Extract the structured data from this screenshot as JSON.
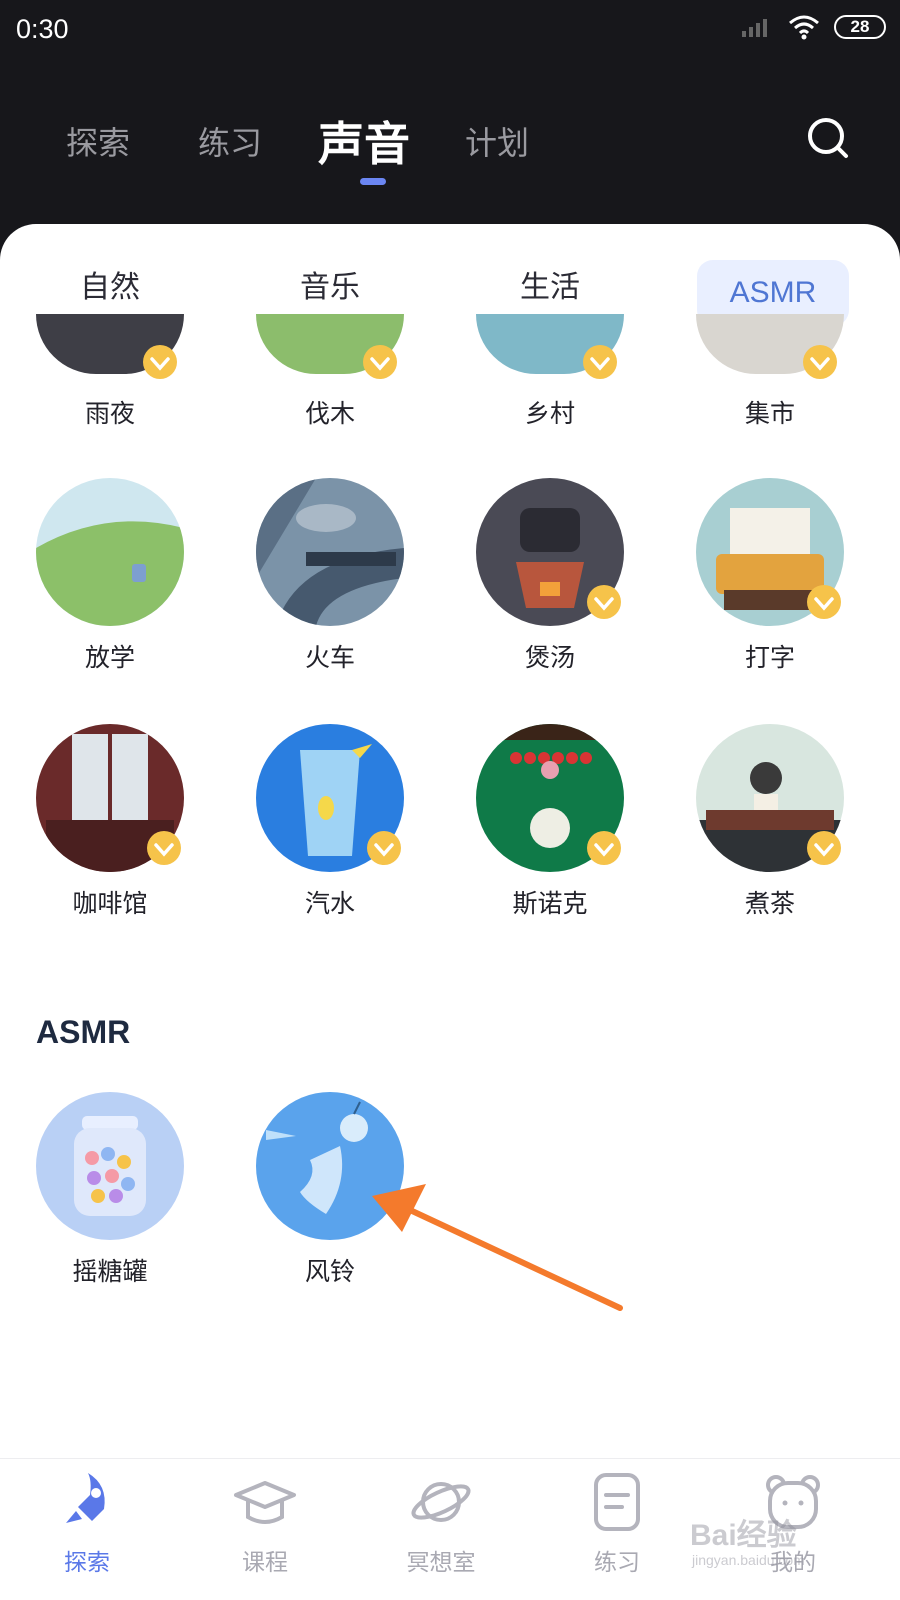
{
  "status_bar": {
    "time": "0:30",
    "battery": "28"
  },
  "top_nav": {
    "tabs": [
      "探索",
      "练习",
      "声音",
      "计划"
    ],
    "active": "声音"
  },
  "sub_tabs": {
    "items": [
      "自然",
      "音乐",
      "生活",
      "ASMR"
    ],
    "active": "ASMR"
  },
  "grid": {
    "row_partial": [
      "雨夜",
      "伐木",
      "乡村",
      "集市"
    ],
    "row_1": [
      "放学",
      "火车",
      "煲汤",
      "打字"
    ],
    "row_2": [
      "咖啡馆",
      "汽水",
      "斯诺克",
      "煮茶"
    ]
  },
  "asmr_section": {
    "title": "ASMR",
    "items": [
      "摇糖罐",
      "风铃"
    ]
  },
  "bottom_nav": {
    "items": [
      "探索",
      "课程",
      "冥想室",
      "练习",
      "我的"
    ],
    "active": "探索"
  },
  "watermark": {
    "text": "Bai经验",
    "sub": "jingyan.baidu.com"
  },
  "colors": {
    "accent": "#5a78e8",
    "vip_badge": "#f6c34a",
    "arrow": "#f47a2c"
  },
  "icons": {
    "search": "search-icon",
    "signal": "signal-icon",
    "wifi": "wifi-icon",
    "battery": "battery-icon",
    "vip": "crown-badge-icon"
  }
}
